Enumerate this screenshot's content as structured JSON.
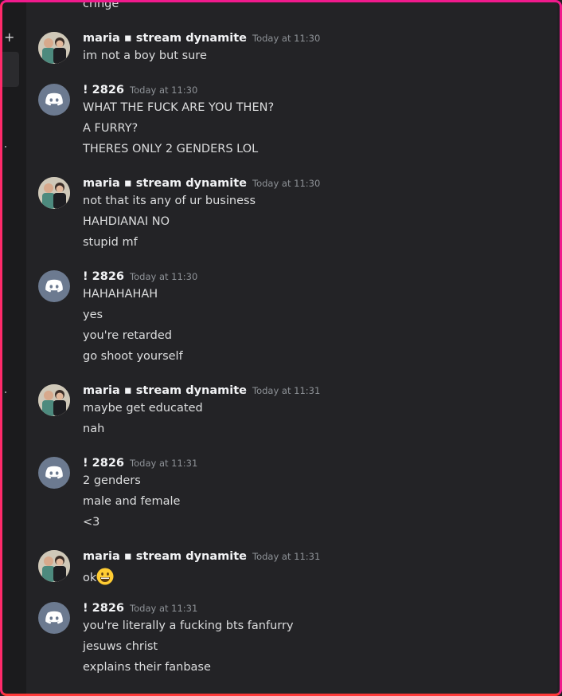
{
  "top_fragment": "cringe",
  "users": {
    "maria": "maria ▪ stream dynamite",
    "other": "! 2826"
  },
  "messages": [
    {
      "author": "maria ▪ stream dynamite",
      "timestamp": "Today at 11:30",
      "avatar": "photo-avatar",
      "lines": [
        "im not a boy but sure"
      ]
    },
    {
      "author": "! 2826",
      "timestamp": "Today at 11:30",
      "avatar": "discord-logo-icon",
      "lines": [
        "WHAT THE FUCK ARE YOU THEN?",
        "A FURRY?",
        "THERES ONLY 2 GENDERS LOL"
      ]
    },
    {
      "author": "maria ▪ stream dynamite",
      "timestamp": "Today at 11:30",
      "avatar": "photo-avatar",
      "lines": [
        "not that its any of ur business",
        "HAHDIANAI NO",
        "stupid mf"
      ]
    },
    {
      "author": "! 2826",
      "timestamp": "Today at 11:30",
      "avatar": "discord-logo-icon",
      "lines": [
        "HAHAHAHAH",
        "yes",
        "you're retarded",
        "go shoot yourself"
      ]
    },
    {
      "author": "maria ▪ stream dynamite",
      "timestamp": "Today at 11:31",
      "avatar": "photo-avatar",
      "lines": [
        "maybe get educated",
        "nah"
      ]
    },
    {
      "author": "! 2826",
      "timestamp": "Today at 11:31",
      "avatar": "discord-logo-icon",
      "lines": [
        "2 genders",
        "male and female",
        "<3"
      ]
    },
    {
      "author": "maria ▪ stream dynamite",
      "timestamp": "Today at 11:31",
      "avatar": "photo-avatar",
      "lines": [
        "ok"
      ],
      "emoji": "grinning-face-emoji-icon"
    },
    {
      "author": "! 2826",
      "timestamp": "Today at 11:31",
      "avatar": "discord-logo-icon",
      "lines": [
        "you're literally a fucking bts fanfurry",
        "jesuws christ",
        "explains their fanbase"
      ]
    }
  ],
  "colors": {
    "background": "#232326",
    "username": "#f2f3f5",
    "message_text": "#dcddde",
    "timestamp": "#8e9297",
    "discord_avatar": "#6c7a90",
    "frame": "#f01a8c"
  }
}
